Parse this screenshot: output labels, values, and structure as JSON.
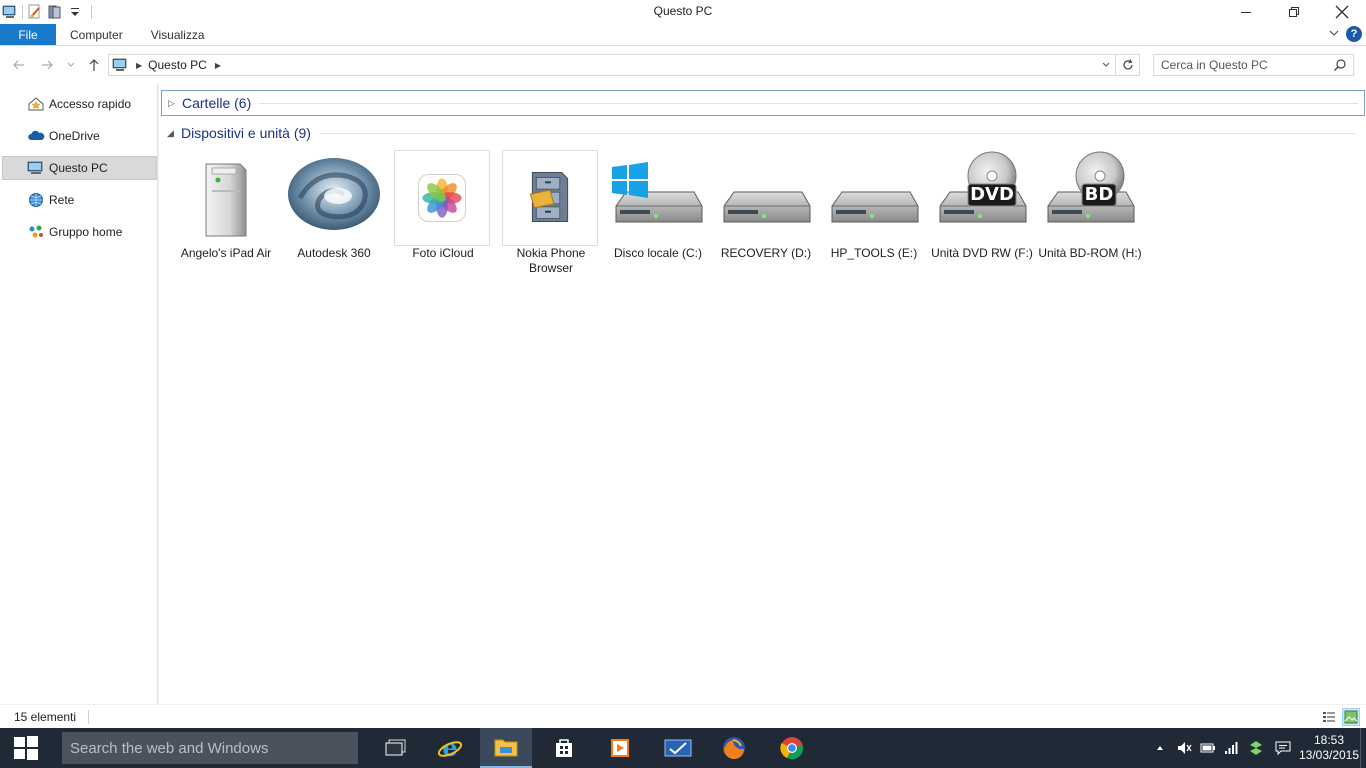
{
  "window": {
    "title": "Questo PC"
  },
  "ribbon": {
    "tabs": [
      {
        "label": "File"
      },
      {
        "label": "Computer"
      },
      {
        "label": "Visualizza"
      }
    ],
    "help_label": "?"
  },
  "address": {
    "crumb": "Questo PC",
    "search_placeholder": "Cerca in Questo PC"
  },
  "navpane": {
    "items": [
      {
        "label": "Accesso rapido",
        "icon": "star-home-icon"
      },
      {
        "label": "OneDrive",
        "icon": "cloud-icon"
      },
      {
        "label": "Questo PC",
        "icon": "computer-icon",
        "selected": true
      },
      {
        "label": "Rete",
        "icon": "network-icon"
      },
      {
        "label": "Gruppo home",
        "icon": "homegroup-icon"
      }
    ]
  },
  "content": {
    "groups": [
      {
        "label": "Cartelle (6)",
        "expanded": false
      },
      {
        "label": "Dispositivi e unità (9)",
        "expanded": true
      }
    ],
    "items": [
      {
        "label": "Angelo's iPad Air",
        "icon": "device-tower-icon"
      },
      {
        "label": "Autodesk 360",
        "icon": "autodesk-icon"
      },
      {
        "label": "Foto iCloud",
        "icon": "icloud-photos-icon"
      },
      {
        "label": "Nokia Phone Browser",
        "icon": "file-cabinet-icon"
      },
      {
        "label": "Disco locale (C:)",
        "icon": "windows-drive-icon"
      },
      {
        "label": "RECOVERY (D:)",
        "icon": "hard-drive-icon"
      },
      {
        "label": "HP_TOOLS (E:)",
        "icon": "hard-drive-icon"
      },
      {
        "label": "Unità DVD RW (F:)",
        "icon": "dvd-drive-icon",
        "badge": "DVD"
      },
      {
        "label": "Unità BD-ROM (H:)",
        "icon": "bd-drive-icon",
        "badge": "BD"
      }
    ]
  },
  "status": {
    "count": "15 elementi"
  },
  "taskbar": {
    "search_placeholder": "Search the web and Windows",
    "time": "18:53",
    "date": "13/03/2015"
  },
  "colors": {
    "accent": "#1979ca",
    "group_header": "#1e3287",
    "taskbar": "#1f2a36"
  }
}
